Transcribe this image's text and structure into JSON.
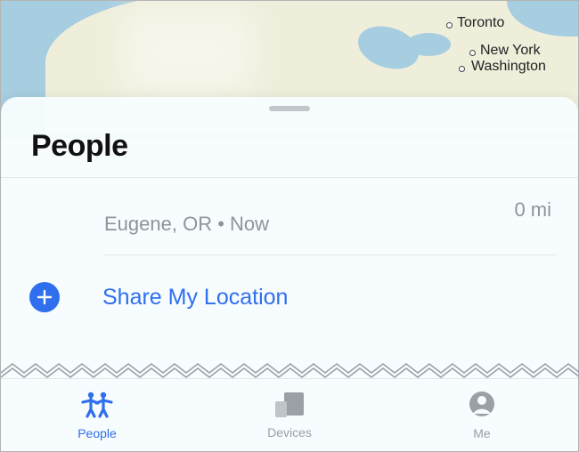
{
  "map": {
    "cities": {
      "toronto": "Toronto",
      "new_york": "New York",
      "washington": "Washington"
    }
  },
  "sheet": {
    "title": "People",
    "person": {
      "location_line": "Eugene, OR • Now",
      "distance": "0 mi"
    },
    "share_label": "Share My Location"
  },
  "tabs": {
    "people": "People",
    "devices": "Devices",
    "me": "Me"
  },
  "colors": {
    "accent": "#2f6fee",
    "inactive": "#9aa0a6"
  }
}
